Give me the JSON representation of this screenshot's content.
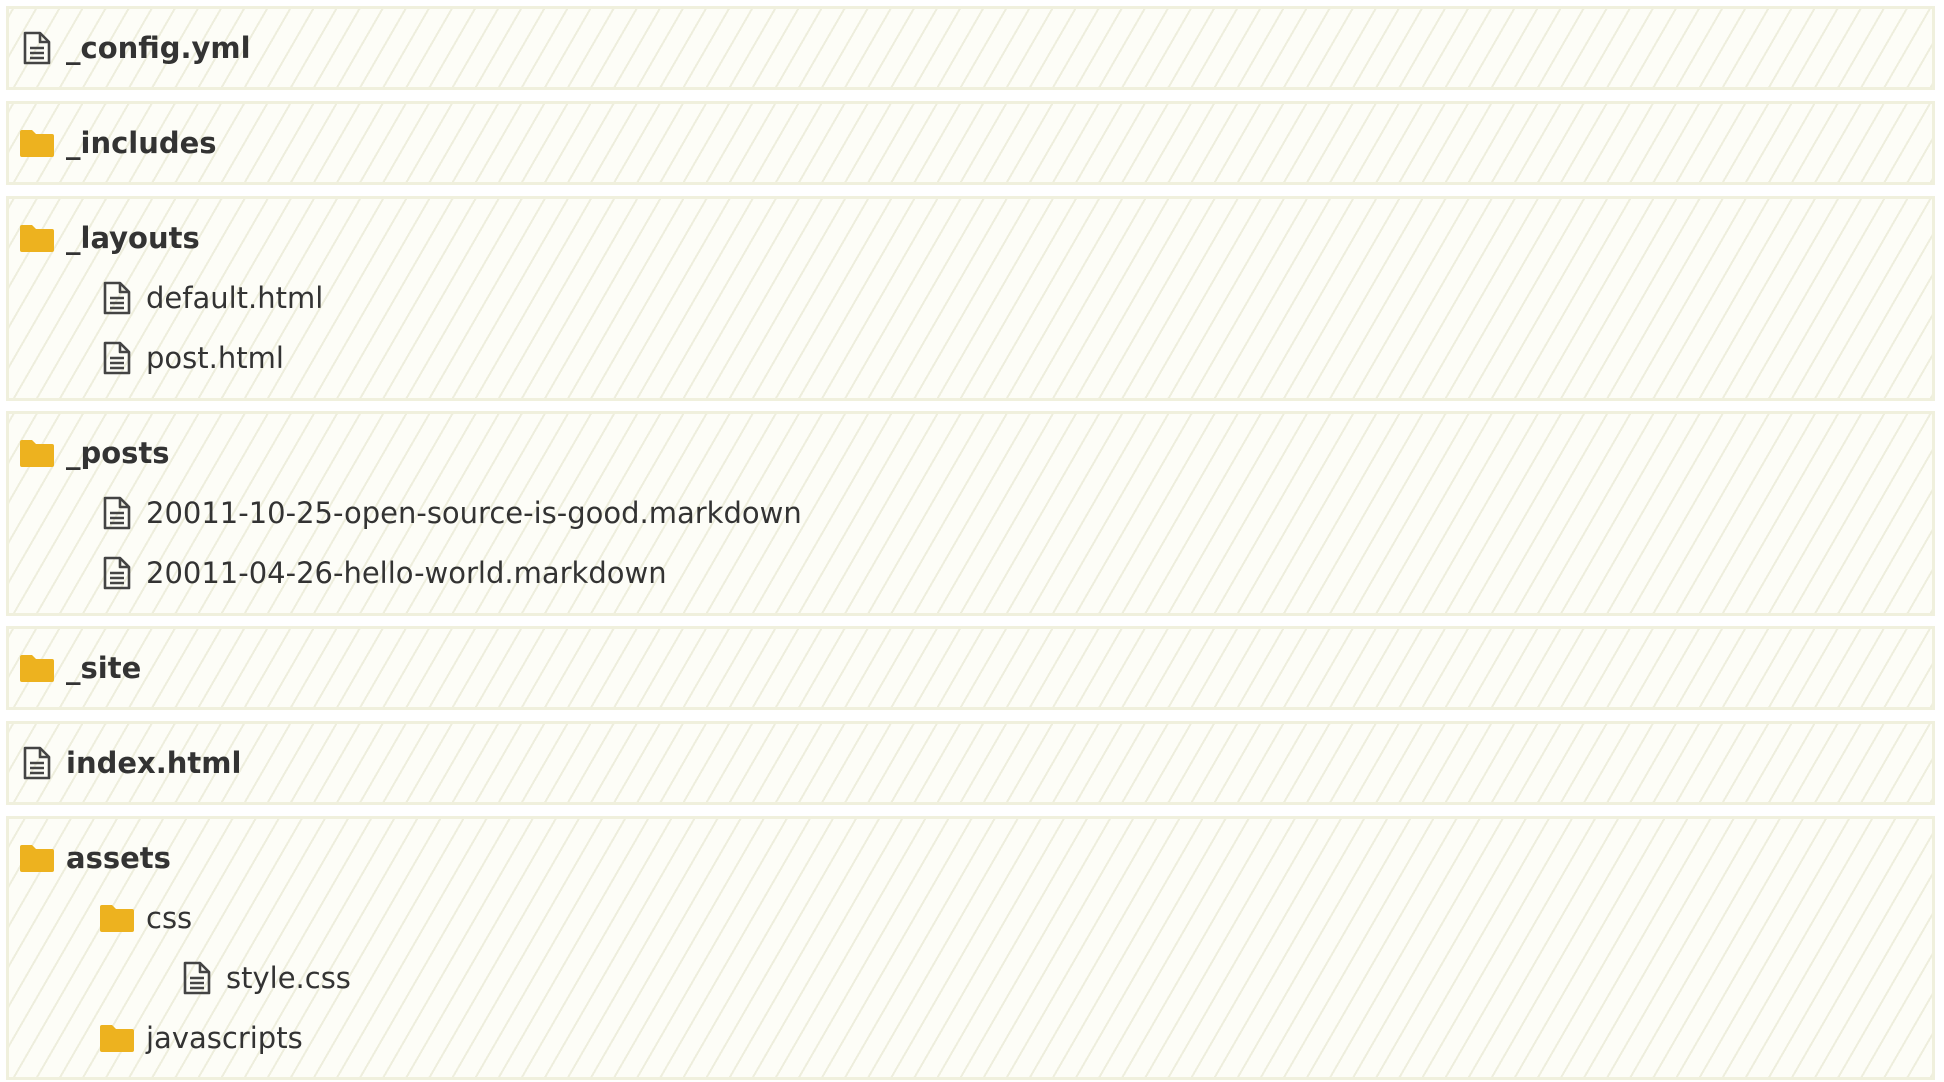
{
  "colors": {
    "folder": "#edb21f",
    "file_icon": "#444444",
    "text": "#333333",
    "group_border": "#f0f0dd",
    "group_background": "#fdfdf7",
    "hatch": "#e2e2c8"
  },
  "tree": [
    {
      "name": "_config.yml",
      "type": "file",
      "icon": "file-icon",
      "children": []
    },
    {
      "name": "_includes",
      "type": "folder",
      "icon": "folder-icon",
      "children": []
    },
    {
      "name": "_layouts",
      "type": "folder",
      "icon": "folder-icon",
      "children": [
        {
          "name": "default.html",
          "type": "file",
          "icon": "file-icon",
          "children": []
        },
        {
          "name": "post.html",
          "type": "file",
          "icon": "file-icon",
          "children": []
        }
      ]
    },
    {
      "name": "_posts",
      "type": "folder",
      "icon": "folder-icon",
      "children": [
        {
          "name": "20011-10-25-open-source-is-good.markdown",
          "type": "file",
          "icon": "file-icon",
          "children": []
        },
        {
          "name": "20011-04-26-hello-world.markdown",
          "type": "file",
          "icon": "file-icon",
          "children": []
        }
      ]
    },
    {
      "name": "_site",
      "type": "folder",
      "icon": "folder-icon",
      "children": []
    },
    {
      "name": "index.html",
      "type": "file",
      "icon": "file-icon",
      "children": []
    },
    {
      "name": "assets",
      "type": "folder",
      "icon": "folder-icon",
      "children": [
        {
          "name": "css",
          "type": "folder",
          "icon": "folder-icon",
          "children": [
            {
              "name": "style.css",
              "type": "file",
              "icon": "file-icon",
              "children": []
            }
          ]
        },
        {
          "name": "javascripts",
          "type": "folder",
          "icon": "folder-icon",
          "children": []
        }
      ]
    }
  ]
}
